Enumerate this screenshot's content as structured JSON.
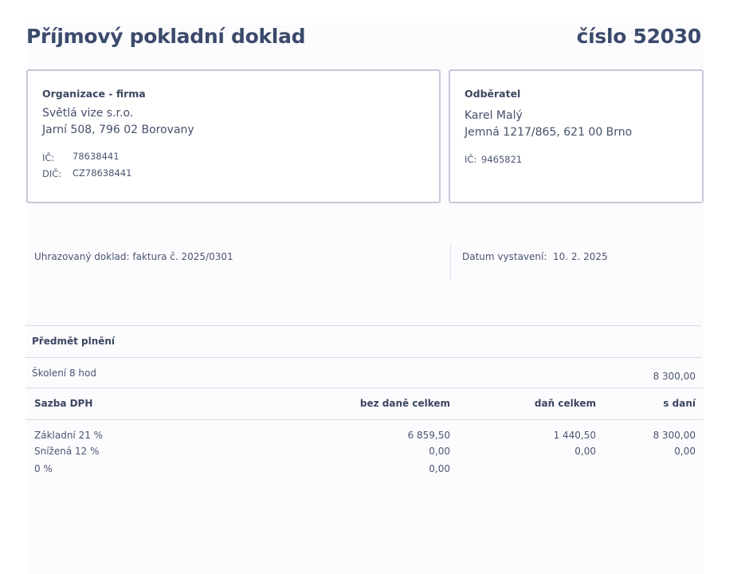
{
  "document": {
    "title": "Příjmový pokladní doklad",
    "number": "číslo 52030"
  },
  "organization": {
    "heading": "Organizace - firma",
    "name": "Světlá vize s.r.o.",
    "address": "Jarní 508, 796 02 Borovany",
    "ic_label": "IČ:",
    "ic_value": "78638441",
    "dic_label": "DIČ:",
    "dic_value": "CZ78638441"
  },
  "customer": {
    "heading": "Odběratel",
    "name": "Karel Malý",
    "address": "Jemná 1217/865, 621 00 Brno",
    "ic_label": "IČ:",
    "ic_value": "9465821"
  },
  "meta": {
    "paid_document": "Uhrazovaný doklad: faktura č. 2025/0301",
    "issue_date_label": "Datum vystavení:",
    "issue_date_value": "10. 2. 2025"
  },
  "subject": {
    "heading": "Předmět plnění",
    "item": "Školení 8 hod",
    "price": "8 300,00"
  },
  "vat_table": {
    "headers": [
      "Sazba DPH",
      "bez daně celkem",
      "daň celkem",
      "s daní"
    ],
    "rows": [
      [
        "Základní 21 %",
        "6 859,50",
        "1 440,50",
        "8 300,00"
      ],
      [
        "Snížená 12 %",
        "0,00",
        "0,00",
        "0,00"
      ],
      [
        "0 %",
        "0,00",
        "",
        ""
      ]
    ]
  }
}
